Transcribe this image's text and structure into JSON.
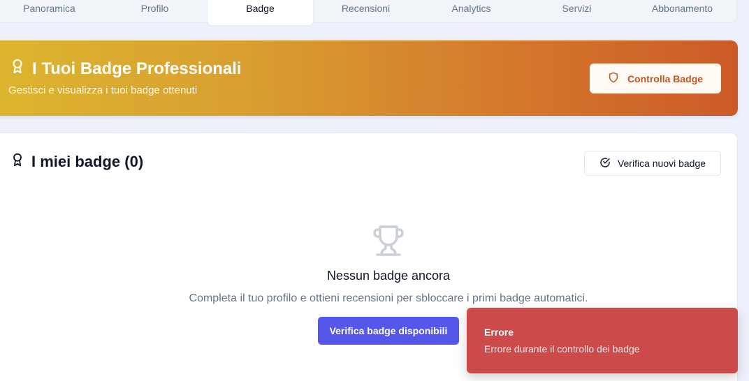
{
  "tabs": [
    {
      "label": "Panoramica",
      "active": false
    },
    {
      "label": "Profilo",
      "active": false
    },
    {
      "label": "Badge",
      "active": true
    },
    {
      "label": "Recensioni",
      "active": false
    },
    {
      "label": "Analytics",
      "active": false
    },
    {
      "label": "Servizi",
      "active": false
    },
    {
      "label": "Abbonamento",
      "active": false
    }
  ],
  "banner": {
    "title": "I Tuoi Badge Professionali",
    "subtitle": "Gestisci e visualizza i tuoi badge ottenuti",
    "button_label": "Controlla Badge",
    "icon": "award-icon",
    "button_icon": "shield-icon"
  },
  "badges_card": {
    "title": "I miei badge (0)",
    "title_icon": "award-icon",
    "verify_button_label": "Verifica nuovi badge",
    "verify_button_icon": "check-circle-icon",
    "empty_state": {
      "icon": "trophy-icon",
      "title": "Nessun badge ancora",
      "description": "Completa il tuo profilo e ottieni recensioni per sbloccare i primi badge automatici.",
      "button_label": "Verifica badge disponibili"
    }
  },
  "toast": {
    "title": "Errore",
    "message": "Errore durante il controllo dei badge",
    "color": "#cc4a4a"
  },
  "colors": {
    "accent": "#5457ea",
    "banner_start": "#dcb52f",
    "banner_end": "#cc5a28"
  }
}
